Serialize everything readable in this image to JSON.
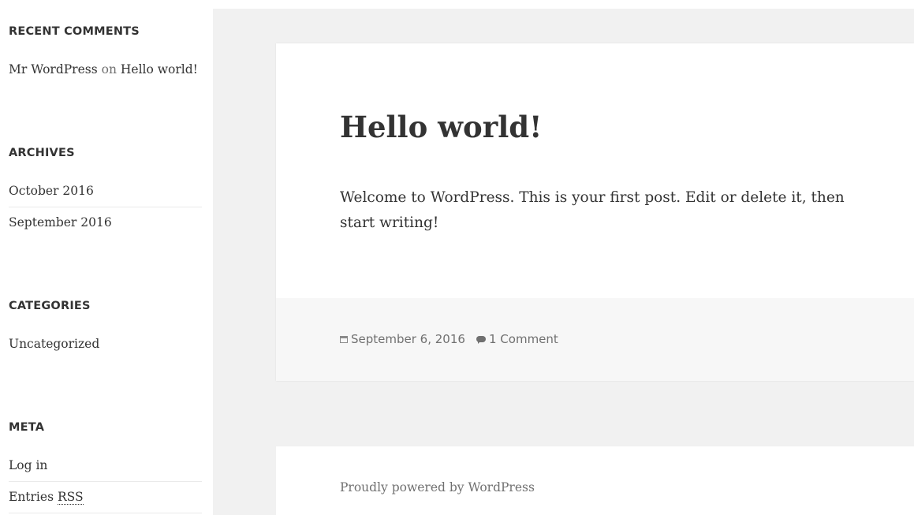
{
  "sidebar": {
    "recent_comments": {
      "title": "RECENT COMMENTS",
      "items": [
        {
          "author": "Mr WordPress",
          "connector": "on",
          "post": "Hello world!"
        }
      ]
    },
    "archives": {
      "title": "ARCHIVES",
      "items": [
        "October 2016",
        "September 2016"
      ]
    },
    "categories": {
      "title": "CATEGORIES",
      "items": [
        "Uncategorized"
      ]
    },
    "meta": {
      "title": "META",
      "login": "Log in",
      "entries_prefix": "Entries ",
      "entries_abbr": "RSS"
    }
  },
  "post": {
    "title": "Hello world!",
    "content": "Welcome to WordPress. This is your first post. Edit or delete it, then start writing!",
    "date": "September 6, 2016",
    "comments": "1 Comment"
  },
  "footer": {
    "credit": "Proudly powered by WordPress"
  },
  "colors": {
    "background": "#f1f1f1",
    "card": "#ffffff",
    "footer_band": "#f7f7f7",
    "text": "#333333",
    "muted": "#707070"
  },
  "icons": {
    "date": "calendar-icon",
    "comments": "comment-bubble-icon"
  }
}
